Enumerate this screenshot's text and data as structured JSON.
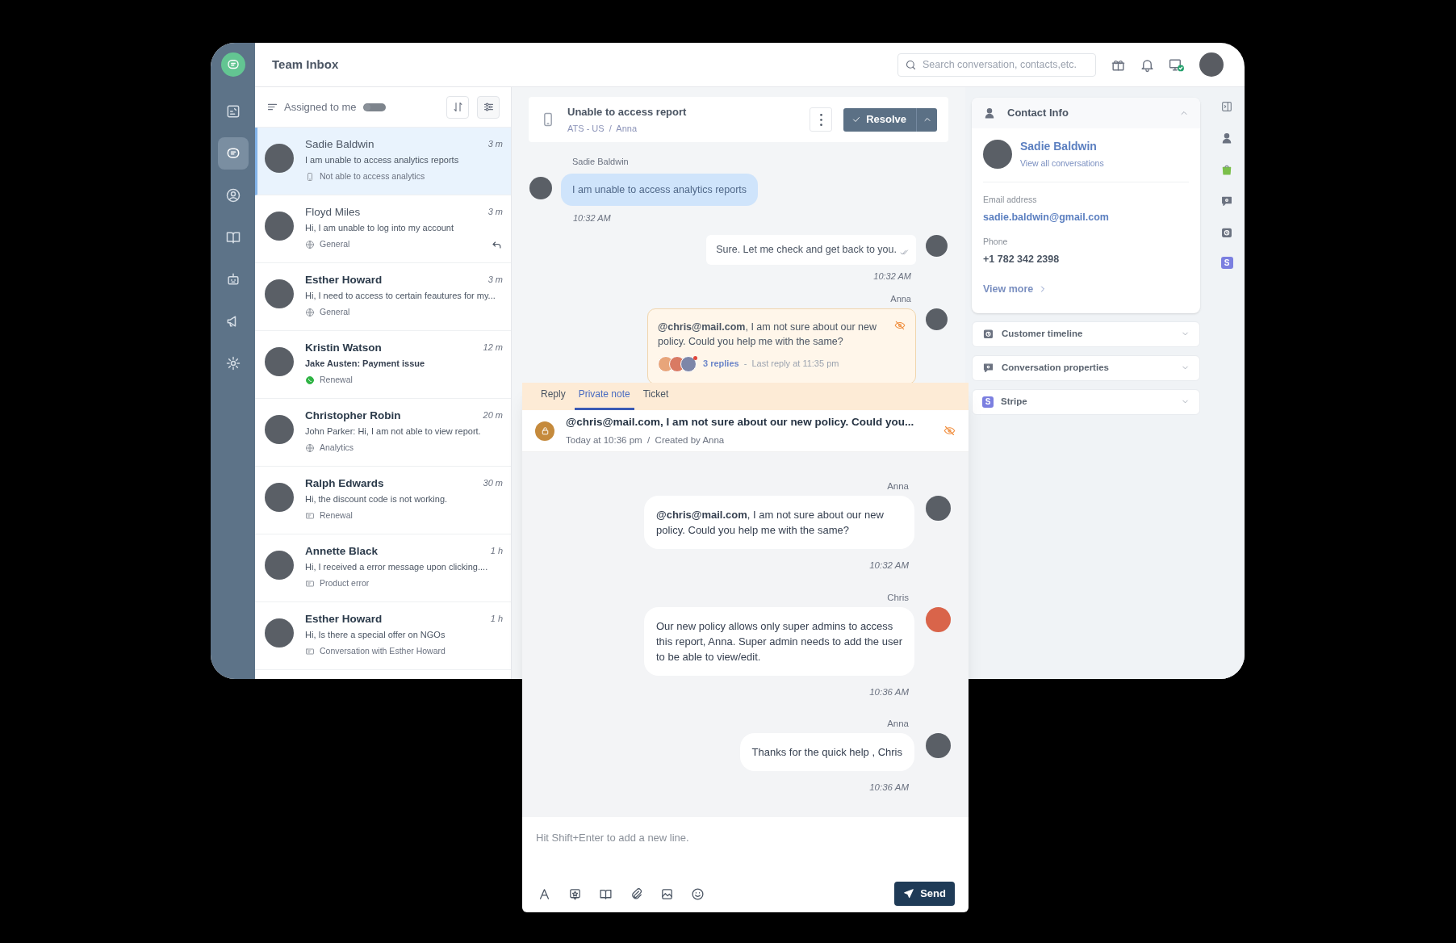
{
  "app": {
    "title": "Team Inbox"
  },
  "search": {
    "placeholder": "Search conversation, contacts,etc."
  },
  "top_icons": [
    {
      "kind": "gift"
    },
    {
      "kind": "bell"
    },
    {
      "kind": "monitor"
    }
  ],
  "sidebar": {
    "items": [
      {
        "kind": "reports",
        "selected": false
      },
      {
        "kind": "chat",
        "selected": true
      },
      {
        "kind": "user",
        "selected": false
      },
      {
        "kind": "book",
        "selected": false
      },
      {
        "kind": "bot",
        "selected": false
      },
      {
        "kind": "megaphone",
        "selected": false
      },
      {
        "kind": "gear",
        "selected": false
      }
    ]
  },
  "list_header": {
    "label": "Assigned to me",
    "toggle_on": false
  },
  "conversations": [
    {
      "name": "Sadie Baldwin",
      "preview": "I am unable to access analytics reports",
      "kind": "phone",
      "tag": "Not able to access analytics",
      "time": "3 m",
      "selected": true,
      "unread": false,
      "replied": false
    },
    {
      "name": "Floyd Miles",
      "preview": "Hi, I am unable to log into my account",
      "kind": "globe",
      "tag": "General",
      "time": "3 m",
      "selected": false,
      "unread": false,
      "replied": true
    },
    {
      "name": "Esther Howard",
      "preview": "Hi, I need to access to certain feautures for my...",
      "kind": "globe",
      "tag": "General",
      "time": "3 m",
      "selected": false,
      "unread": true,
      "replied": false
    },
    {
      "name": "Kristin Watson",
      "preview": "Jake Austen: Payment issue",
      "kind": "whatsapp",
      "tag": "Renewal",
      "time": "12 m",
      "selected": false,
      "unread": true,
      "replied": false
    },
    {
      "name": "Christopher Robin",
      "preview": "John Parker: Hi, I am not able to view report.",
      "kind": "globe",
      "tag": "Analytics",
      "time": "20 m",
      "selected": false,
      "unread": true,
      "replied": false
    },
    {
      "name": "Ralph Edwards",
      "preview": "Hi, the discount code is not working.",
      "kind": "ticket",
      "tag": "Renewal",
      "time": "30 m",
      "selected": false,
      "unread": true,
      "replied": false
    },
    {
      "name": "Annette Black",
      "preview": "Hi, I received a error message upon clicking....",
      "kind": "ticket",
      "tag": "Product error",
      "time": "1 h",
      "selected": false,
      "unread": true,
      "replied": false
    },
    {
      "name": "Esther Howard",
      "preview": "Hi, Is there a special offer on NGOs",
      "kind": "ticket",
      "tag": "Conversation with Esther Howard",
      "time": "1 h",
      "selected": false,
      "unread": true,
      "replied": false
    }
  ],
  "chat": {
    "title": "Unable to access report",
    "breadcrumb": "ATS - US  /  Anna",
    "resolve": "Resolve",
    "messages": [
      {
        "kind": "incoming",
        "sender": "Sadie Baldwin",
        "text": "I am unable to access analytics reports",
        "time": "10:32 AM"
      },
      {
        "kind": "outgoing",
        "text": "Sure. Let me check and get back to you.",
        "time": "10:32 AM",
        "read": true
      },
      {
        "kind": "note",
        "sender": "Anna",
        "text": "**@chris@mail.com**, I am not sure about our new policy. Could you help me with the same?",
        "replies": "3 replies",
        "last_reply": "-  Last reply at 11:35 pm"
      }
    ]
  },
  "thread_panel": {
    "tabs": [
      {
        "label": "Reply",
        "selected": false
      },
      {
        "label": "Private note",
        "selected": true
      },
      {
        "label": "Ticket",
        "selected": false
      }
    ],
    "note": {
      "text": "@chris@mail.com, I am not sure about our new policy. Could you...",
      "meta": "Today at 10:36 pm  /  Created by Anna"
    },
    "messages": [
      {
        "sender": "Anna",
        "text": "**@chris@mail.com**, I am not sure about our new policy. Could you help me with the same?",
        "time": "10:32 AM"
      },
      {
        "sender": "Chris",
        "text": "Our new policy allows only super admins to access this report, Anna. Super admin needs to add the user to be able to view/edit.",
        "time": "10:36 AM"
      },
      {
        "sender": "Anna",
        "text": "Thanks for the quick help , Chris",
        "time": "10:36 AM"
      }
    ],
    "input": {
      "placeholder": "Hit Shift+Enter to add a new line."
    },
    "tools": [
      {
        "kind": "font"
      },
      {
        "kind": "starbox"
      },
      {
        "kind": "book"
      },
      {
        "kind": "clip"
      },
      {
        "kind": "image"
      },
      {
        "kind": "smile"
      }
    ],
    "send": "Send"
  },
  "contact": {
    "header": "Contact Info",
    "expanded": true,
    "name": "Sadie Baldwin",
    "link": "View all conversations",
    "fields": [
      {
        "label": "Email address",
        "value": "sadie.baldwin@gmail.com",
        "kind": "link"
      },
      {
        "label": "Phone",
        "value": "+1 782 342 2398",
        "kind": "text"
      }
    ],
    "more": "View more"
  },
  "sections": [
    {
      "title": "Customer timeline",
      "kind": "clock",
      "expanded": false
    },
    {
      "title": "Conversation properties",
      "kind": "chatgear",
      "expanded": false
    },
    {
      "title": "Stripe",
      "kind": "stripe",
      "badge": "S",
      "expanded": false
    }
  ],
  "rail": [
    {
      "kind": "panel"
    },
    {
      "kind": "person"
    },
    {
      "kind": "bag"
    },
    {
      "kind": "chatgear"
    },
    {
      "kind": "clock"
    },
    {
      "kind": "stripe",
      "badge": "S"
    }
  ]
}
